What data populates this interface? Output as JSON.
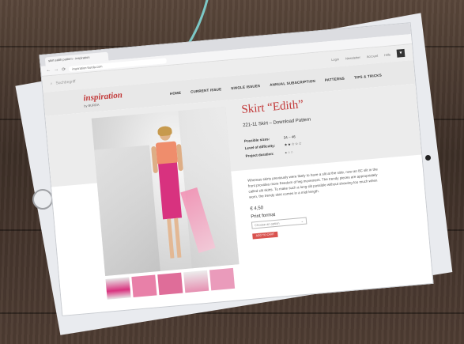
{
  "browser": {
    "tab_title": "skirt edith pattern - inspiration",
    "url": "inspiration-burda.com",
    "back": "←",
    "forward": "→",
    "reload": "⟳"
  },
  "site": {
    "search_placeholder": "Suchbegriff",
    "util_links": [
      "Login",
      "Newsletter",
      "Account",
      "Hilfe"
    ],
    "cart_icon": "cart-icon",
    "logo_main": "inspiration",
    "logo_sub": "by BURDA",
    "nav": [
      "HOME",
      "CURRENT ISSUE",
      "SINGLE ISSUES",
      "ANNUAL SUBSCRIPTION",
      "PATTERNS",
      "TIPS & TRICKS"
    ]
  },
  "product": {
    "title": "Skirt “Edith”",
    "subtitle": "221-11 Skirt – Download Pattern",
    "specs": [
      {
        "label": "Possible sizes:",
        "value": "34 – 46"
      },
      {
        "label": "Level of difficulty:",
        "value": "★★☆☆☆"
      },
      {
        "label": "Project duration:",
        "value": "●○○"
      }
    ],
    "description": "Whereas skirts previously were likely to have a slit at the side, now an 8C slit in the front provides more freedom of leg movement. The trendy pieces are appropriately called slit skirts. To make such a long slit possible without showing too much when worn, the trendy skirt comes in a midi length.",
    "price": "€ 4,50",
    "format_label": "Print format",
    "select_placeholder": "Choose an option",
    "select_arrow": "⌄",
    "cart_button": "ADD TO CART"
  },
  "colors": {
    "brand": "#c23a3a",
    "skirt": "#d8327f",
    "button": "#d9534f"
  }
}
